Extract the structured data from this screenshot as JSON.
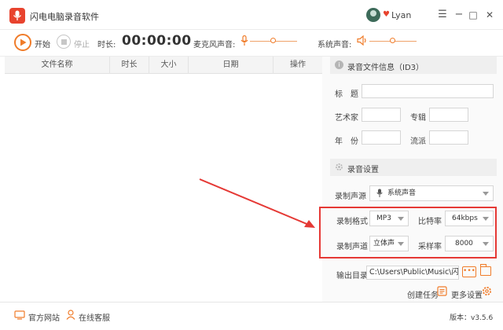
{
  "app": {
    "title": "闪电电脑录音软件",
    "user_name": "Lyan"
  },
  "window_controls": {
    "menu": "☰",
    "minimize": "−",
    "maximize": "□",
    "close": "✕"
  },
  "toolbar": {
    "start_label": "开始",
    "stop_label": "停止",
    "duration_label": "时长:",
    "duration_value": "00:00:00",
    "mic_label": "麦克风声音:",
    "system_label": "系统声音:",
    "mic_volume": 0.5,
    "system_volume": 0.5
  },
  "file_table": {
    "columns": [
      "文件名称",
      "时长",
      "大小",
      "日期",
      "操作"
    ],
    "rows": []
  },
  "id3": {
    "section_title": "录音文件信息（ID3）",
    "title_label": "标　题",
    "artist_label": "艺术家",
    "album_label": "专辑",
    "year_label": "年　份",
    "genre_label": "流派",
    "title_value": "",
    "artist_value": "",
    "album_value": "",
    "year_value": "",
    "genre_value": ""
  },
  "settings": {
    "section_title": "录音设置",
    "source_label": "录制声源",
    "source_value": "系统声音",
    "format_label": "录制格式",
    "format_value": "MP3",
    "bitrate_label": "比特率",
    "bitrate_value": "64kbps",
    "channel_label": "录制声道",
    "channel_value": "立体声",
    "samplerate_label": "采样率",
    "samplerate_value": "8000",
    "output_label": "输出目录",
    "output_value": "C:\\Users\\Public\\Music\\闪电",
    "browse_label": "•••"
  },
  "actions": {
    "create_task": "创建任务",
    "more_settings": "更多设置"
  },
  "statusbar": {
    "website": "官方网站",
    "support": "在线客服",
    "version": "版本：v3.5.6"
  },
  "colors": {
    "accent": "#f07c2a",
    "logo": "#e8432e",
    "annotation": "#e53935"
  }
}
